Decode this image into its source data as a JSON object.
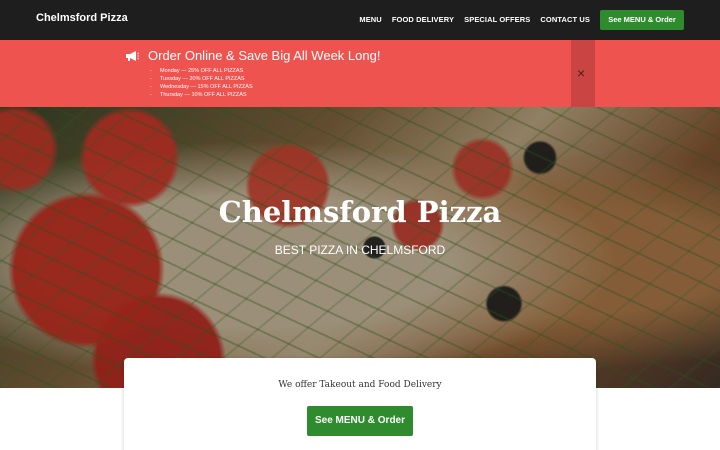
{
  "navbar": {
    "brand": "Chelmsford Pizza",
    "links": [
      "MENU",
      "FOOD DELIVERY",
      "SPECIAL OFFERS",
      "CONTACT US"
    ],
    "cta_label": "See MENU & Order",
    "cta_color": "#2e8b2e",
    "background": "#1e1e1e"
  },
  "promo": {
    "icon": "megaphone-icon",
    "title": "Order Online & Save Big All Week Long!",
    "deals": [
      "Monday — 25% OFF ALL PIZZAS",
      "Tuesday — 20% OFF ALL PIZZAS",
      "Wednesday — 15% OFF ALL PIZZAS",
      "Thursday — 10% OFF ALL PIZZAS"
    ],
    "close_icon": "close-icon",
    "close_symbol": "×",
    "background": "#ef5350"
  },
  "hero": {
    "title": "Chelmsford Pizza",
    "subtitle": "BEST PIZZA IN CHELMSFORD"
  },
  "card": {
    "text": "We offer Takeout and Food Delivery",
    "cta_label": "See MENU & Order"
  }
}
